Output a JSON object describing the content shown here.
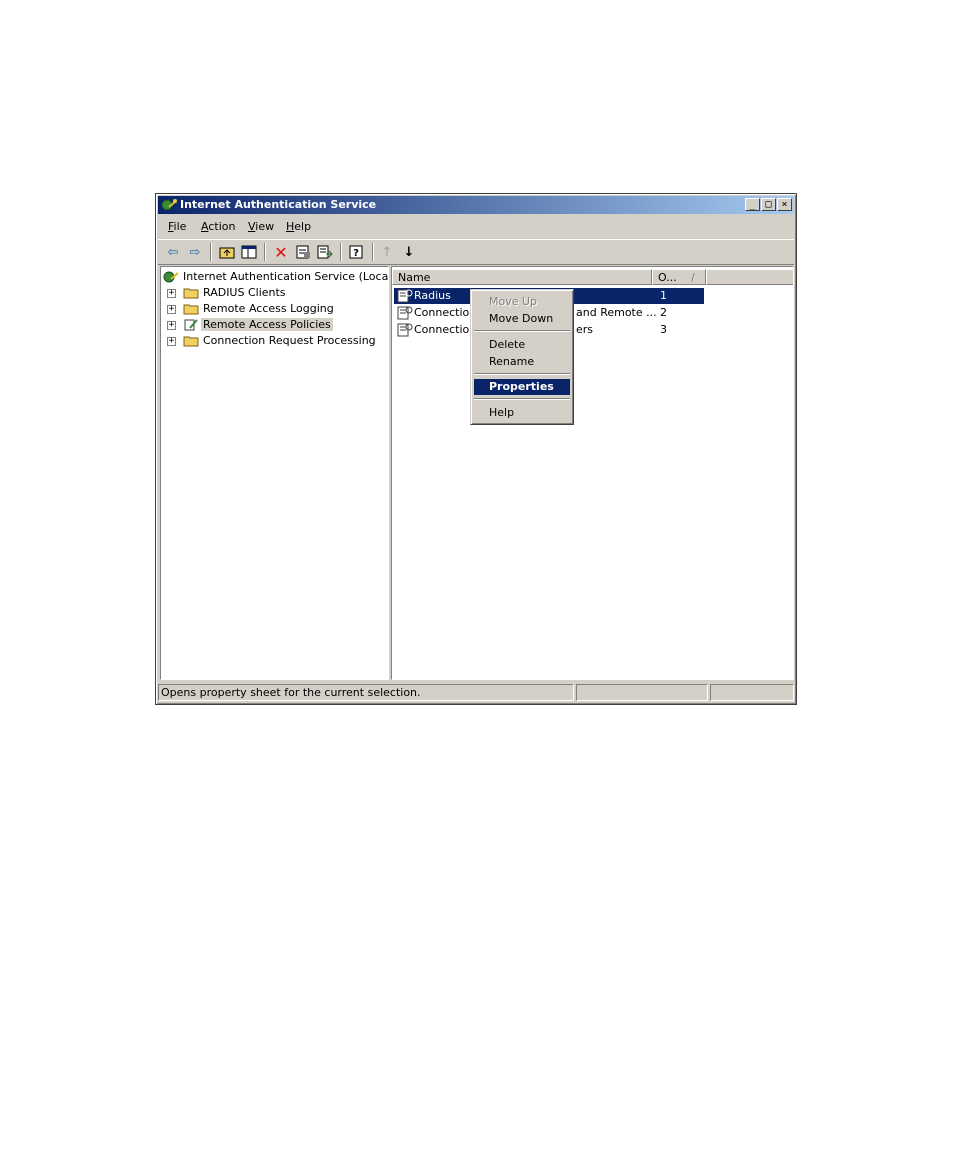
{
  "window": {
    "title": "Internet Authentication Service",
    "controls": {
      "minimize": "_",
      "maximize": "□",
      "close": "×"
    }
  },
  "menu": [
    {
      "label": "File",
      "accel": "F",
      "rest": "ile"
    },
    {
      "label": "Action",
      "accel": "A",
      "rest": "ction"
    },
    {
      "label": "View",
      "accel": "V",
      "rest": "iew"
    },
    {
      "label": "Help",
      "accel": "H",
      "rest": "elp"
    }
  ],
  "toolbar": {
    "icons": [
      "back-arrow-icon",
      "forward-arrow-icon",
      "up-folder-icon",
      "show-hide-tree-icon",
      "delete-icon",
      "properties-icon",
      "export-list-icon",
      "help-icon",
      "move-up-icon",
      "move-down-icon"
    ],
    "glyphs": {
      "back": "⇦",
      "forward": "⇨",
      "delete": "✕",
      "up": "↑",
      "down": "↓",
      "help": "?"
    }
  },
  "tree": {
    "root": "Internet Authentication Service (Local)",
    "items": [
      {
        "label": "RADIUS Clients",
        "expander": "+"
      },
      {
        "label": "Remote Access Logging",
        "expander": "+"
      },
      {
        "label": "Remote Access Policies",
        "expander": "+"
      },
      {
        "label": "Connection Request Processing",
        "expander": "+"
      }
    ]
  },
  "list": {
    "columns": {
      "name": "Name",
      "order": "O...",
      "sort_glyph": "/"
    },
    "rows": [
      {
        "name": "Radius",
        "order": "1"
      },
      {
        "name": "Connections",
        "name_tail": "and Remote ...",
        "order": "2"
      },
      {
        "name": "Connections",
        "name_tail": "ers",
        "order": "3"
      }
    ]
  },
  "context_menu": {
    "items": [
      {
        "label": "Move Up",
        "enabled": false
      },
      {
        "label": "Move Down",
        "enabled": true
      },
      {
        "label": "Delete",
        "enabled": true
      },
      {
        "label": "Rename",
        "enabled": true
      },
      {
        "label": "Properties",
        "enabled": true,
        "highlighted": true
      },
      {
        "label": "Help",
        "enabled": true
      }
    ]
  },
  "status": {
    "text": "Opens property sheet for the current selection."
  },
  "colors": {
    "selection": "#0a246a",
    "face": "#d4d0c8",
    "title_start": "#0a246a",
    "title_end": "#a6caf0"
  }
}
